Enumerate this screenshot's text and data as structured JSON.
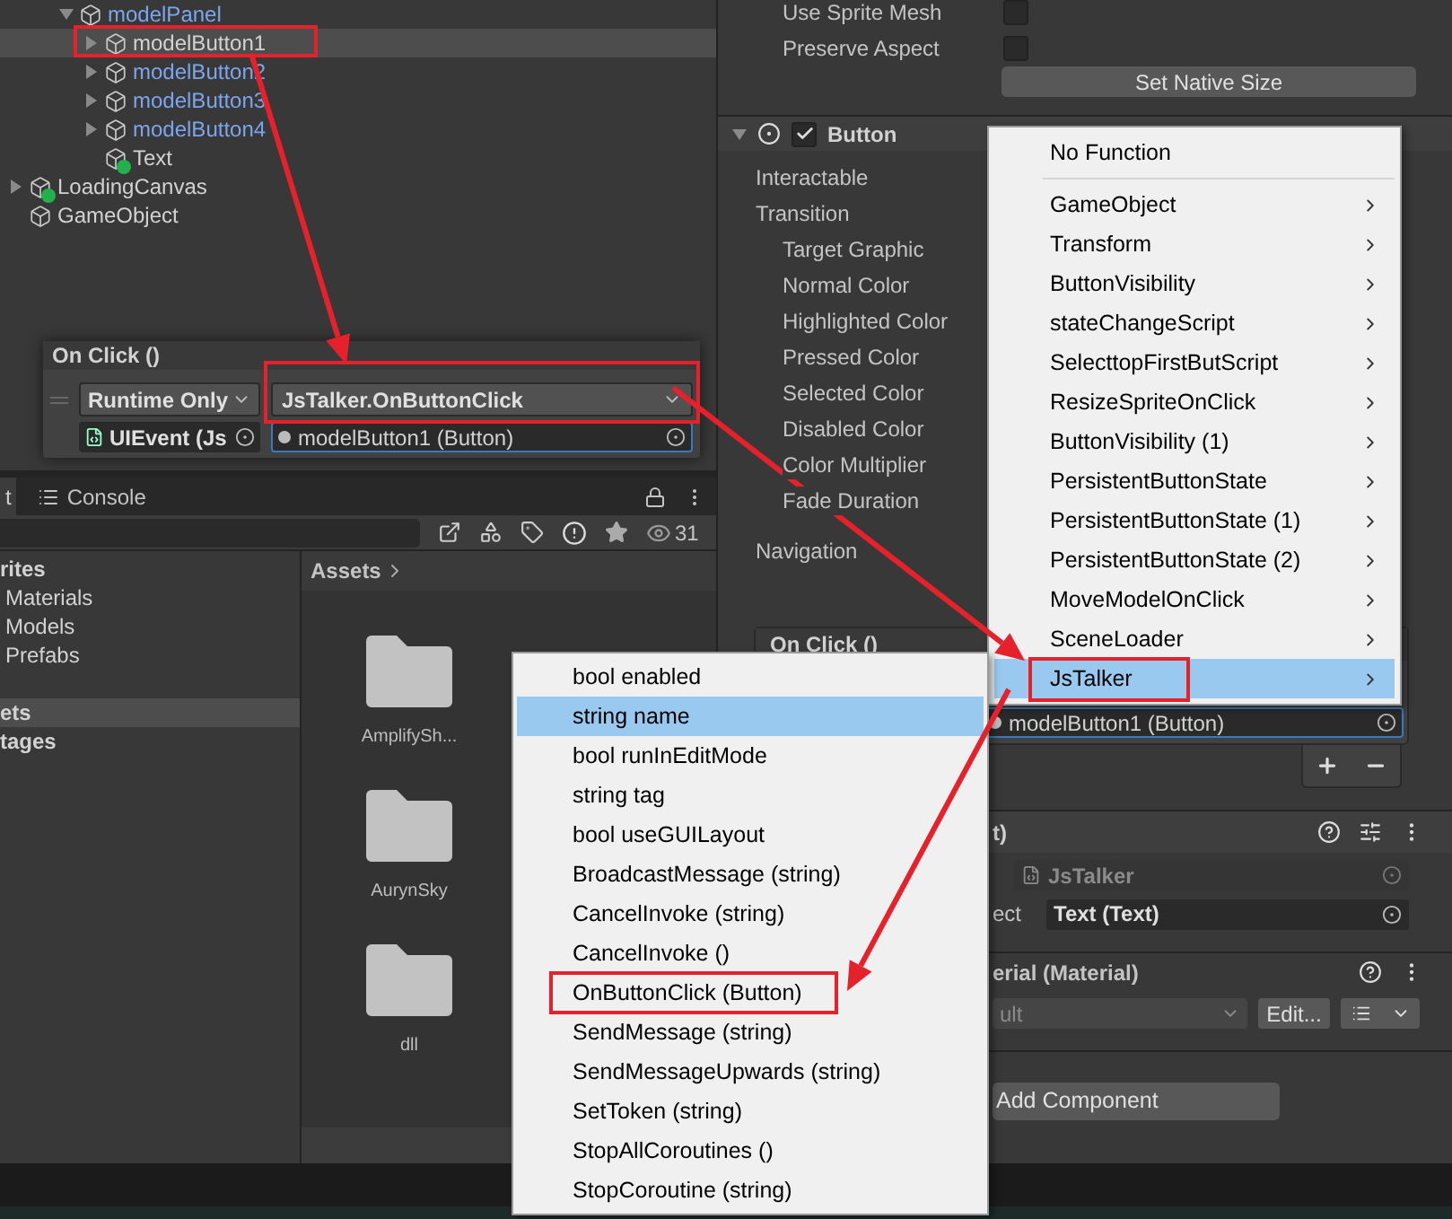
{
  "hierarchy": {
    "nested_items": [
      {
        "name": "modelPanel",
        "kind": "gameobject",
        "prefab": true,
        "expanded": true,
        "selected": false,
        "annotated": false,
        "children": [
          {
            "name": "modelButton1",
            "kind": "gameobject",
            "prefab": false,
            "expanded": false,
            "selected": true,
            "annotated": true
          },
          {
            "name": "modelButton2",
            "kind": "gameobject",
            "prefab": true,
            "expanded": false,
            "selected": false,
            "annotated": false
          },
          {
            "name": "modelButton3",
            "kind": "gameobject",
            "prefab": true,
            "expanded": false,
            "selected": false,
            "annotated": false
          },
          {
            "name": "modelButton4",
            "kind": "gameobject",
            "prefab": true,
            "expanded": false,
            "selected": false,
            "annotated": false
          },
          {
            "name": "Text",
            "kind": "ui-element",
            "prefab": false,
            "selected": false,
            "annotated": false
          }
        ]
      }
    ],
    "root_items": [
      {
        "name": "LoadingCanvas",
        "kind": "ui-element",
        "prefab": false,
        "expanded": false,
        "selected": false,
        "annotated": false
      },
      {
        "name": "GameObject",
        "kind": "gameobject",
        "prefab": false,
        "selected": false,
        "annotated": false
      }
    ]
  },
  "on_click_preview": {
    "title": "On Click ()",
    "runtime": "Runtime Only",
    "function": "JsTalker.OnButtonClick",
    "function_annotated": true,
    "target": "UIEvent (Js",
    "argument": "modelButton1 (Button)"
  },
  "project": {
    "tabs": [
      {
        "label": "t",
        "selected": true
      },
      {
        "label": "Console",
        "selected": false
      }
    ],
    "count": "31",
    "sidebar": [
      {
        "label": "rites",
        "kind": "header",
        "selected": false
      },
      {
        "label": "Materials",
        "kind": "item",
        "selected": false
      },
      {
        "label": "Models",
        "kind": "item",
        "selected": false
      },
      {
        "label": "Prefabs",
        "kind": "item",
        "selected": false
      },
      {
        "label": "ets",
        "kind": "header",
        "selected": true
      },
      {
        "label": "tages",
        "kind": "header",
        "selected": false
      }
    ],
    "breadcrumb": "Assets",
    "folders": [
      {
        "name": "AmplifySh..."
      },
      {
        "name": "AurynSky"
      },
      {
        "name": "dll"
      }
    ]
  },
  "inspector": {
    "image_fields": [
      {
        "label": "Use Sprite Mesh",
        "checked": false
      },
      {
        "label": "Preserve Aspect",
        "checked": false
      }
    ],
    "native_size_button": "Set Native Size",
    "button_component": {
      "title": "Button",
      "expanded": true,
      "enabled": true,
      "properties": [
        {
          "label": "Interactable"
        },
        {
          "label": "Transition",
          "children": [
            {
              "label": "Target Graphic"
            },
            {
              "label": "Normal Color"
            },
            {
              "label": "Highlighted Color"
            },
            {
              "label": "Pressed Color"
            },
            {
              "label": "Selected Color"
            },
            {
              "label": "Disabled Color"
            },
            {
              "label": "Color Multiplier"
            },
            {
              "label": "Fade Duration"
            }
          ]
        },
        {
          "label": "Navigation"
        }
      ]
    },
    "on_click": {
      "title": "On Click ()",
      "argument": "modelButton1 (Button)"
    },
    "script_component": {
      "title": "t)",
      "script": "JsTalker",
      "field_label": "ect",
      "field_value": "Text (Text)"
    },
    "material": {
      "title": "erial (Material)",
      "shader": "ult",
      "edit_button": "Edit..."
    },
    "add_component": "Add Component"
  },
  "function_menu": {
    "items": [
      {
        "label": "No Function",
        "kind": "plain",
        "selected": false,
        "annotated": false
      },
      {
        "kind": "separator"
      },
      {
        "label": "GameObject",
        "kind": "submenu",
        "selected": false,
        "annotated": false
      },
      {
        "label": "Transform",
        "kind": "submenu",
        "selected": false,
        "annotated": false
      },
      {
        "label": "ButtonVisibility",
        "kind": "submenu",
        "selected": false,
        "annotated": false
      },
      {
        "label": "stateChangeScript",
        "kind": "submenu",
        "selected": false,
        "annotated": false
      },
      {
        "label": "SelecttopFirstButScript",
        "kind": "submenu",
        "selected": false,
        "annotated": false
      },
      {
        "label": "ResizeSpriteOnClick",
        "kind": "submenu",
        "selected": false,
        "annotated": false
      },
      {
        "label": "ButtonVisibility (1)",
        "kind": "submenu",
        "selected": false,
        "annotated": false
      },
      {
        "label": "PersistentButtonState",
        "kind": "submenu",
        "selected": false,
        "annotated": false
      },
      {
        "label": "PersistentButtonState (1)",
        "kind": "submenu",
        "selected": false,
        "annotated": false
      },
      {
        "label": "PersistentButtonState (2)",
        "kind": "submenu",
        "selected": false,
        "annotated": false
      },
      {
        "label": "MoveModelOnClick",
        "kind": "submenu",
        "selected": false,
        "annotated": false
      },
      {
        "label": "SceneLoader",
        "kind": "submenu",
        "selected": false,
        "annotated": false
      },
      {
        "label": "JsTalker",
        "kind": "submenu",
        "selected": true,
        "annotated": true
      }
    ]
  },
  "method_menu": {
    "items": [
      {
        "label": "bool enabled",
        "selected": false,
        "annotated": false
      },
      {
        "label": "string name",
        "selected": true,
        "annotated": false
      },
      {
        "label": "bool runInEditMode",
        "selected": false,
        "annotated": false
      },
      {
        "label": "string tag",
        "selected": false,
        "annotated": false
      },
      {
        "label": "bool useGUILayout",
        "selected": false,
        "annotated": false
      },
      {
        "label": "BroadcastMessage (string)",
        "selected": false,
        "annotated": false
      },
      {
        "label": "CancelInvoke (string)",
        "selected": false,
        "annotated": false
      },
      {
        "label": "CancelInvoke ()",
        "selected": false,
        "annotated": false
      },
      {
        "label": "OnButtonClick (Button)",
        "selected": false,
        "annotated": true
      },
      {
        "label": "SendMessage (string)",
        "selected": false,
        "annotated": false
      },
      {
        "label": "SendMessageUpwards (string)",
        "selected": false,
        "annotated": false
      },
      {
        "label": "SetToken (string)",
        "selected": false,
        "annotated": false
      },
      {
        "label": "StopAllCoroutines ()",
        "selected": false,
        "annotated": false
      },
      {
        "label": "StopCoroutine (string)",
        "selected": false,
        "annotated": false
      }
    ]
  }
}
